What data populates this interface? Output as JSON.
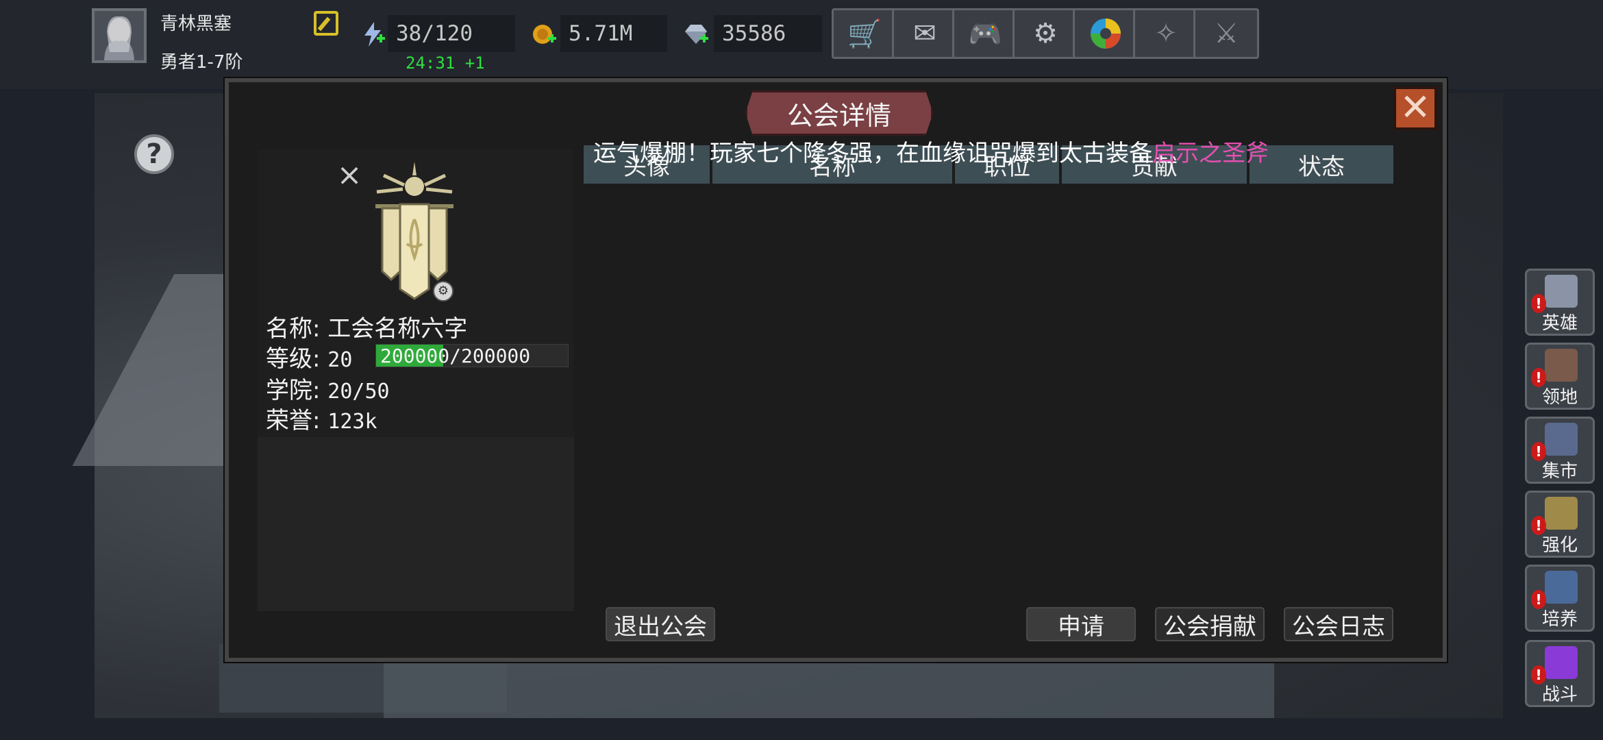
{
  "player": {
    "name": "青林黑塞",
    "rank": "勇者1-7阶"
  },
  "resources": {
    "energy": "38/120",
    "energy_timer": "24:31 +1",
    "gold": "5.71M",
    "gems": "35586"
  },
  "toolbar_icons": [
    "cart-icon",
    "mail-icon",
    "gamepad-icon",
    "settings-gear-icon",
    "color-wheel-icon",
    "skill-tree-icon",
    "swords-icon"
  ],
  "dialog": {
    "title": "公会详情",
    "close_glyph": "✕",
    "marquee_text": "运气爆棚！玩家七个隆冬强，在血缘诅咒爆到太古装备",
    "marquee_highlight": "启示之圣斧",
    "guild": {
      "name_label": "名称:",
      "name_value": "工会名称六字",
      "level_label": "等级:",
      "level_value": "20",
      "xp_text": "200000/200000",
      "xp_fraction": 1.0,
      "academy_label": "学院:",
      "academy_value": "20/50",
      "honor_label": "荣誉:",
      "honor_value": "123k"
    },
    "table_headers": [
      "头像",
      "名称",
      "职位",
      "贡献",
      "状态"
    ],
    "buttons": {
      "quit": "退出公会",
      "apply": "申请",
      "donate": "公会捐献",
      "log": "公会日志"
    }
  },
  "side_menu": [
    {
      "label": "英雄",
      "icon": "helmet-icon",
      "alert": "!"
    },
    {
      "label": "领地",
      "icon": "castle-icon",
      "alert": "!"
    },
    {
      "label": "集市",
      "icon": "shop-icon",
      "alert": "!"
    },
    {
      "label": "强化",
      "icon": "crystal-icon",
      "alert": "!"
    },
    {
      "label": "培养",
      "icon": "chalice-icon",
      "alert": "!"
    },
    {
      "label": "战斗",
      "icon": "portal-icon",
      "alert": "!"
    }
  ],
  "colors": {
    "dialog_bg": "#1c1c1c",
    "title_banner": "#7a4044",
    "close_button": "#b5502a",
    "xp_fill": "#2eaa3a",
    "timer": "#2ee040",
    "marquee_highlight": "#e44fb0",
    "alert": "#cc1a1a"
  }
}
